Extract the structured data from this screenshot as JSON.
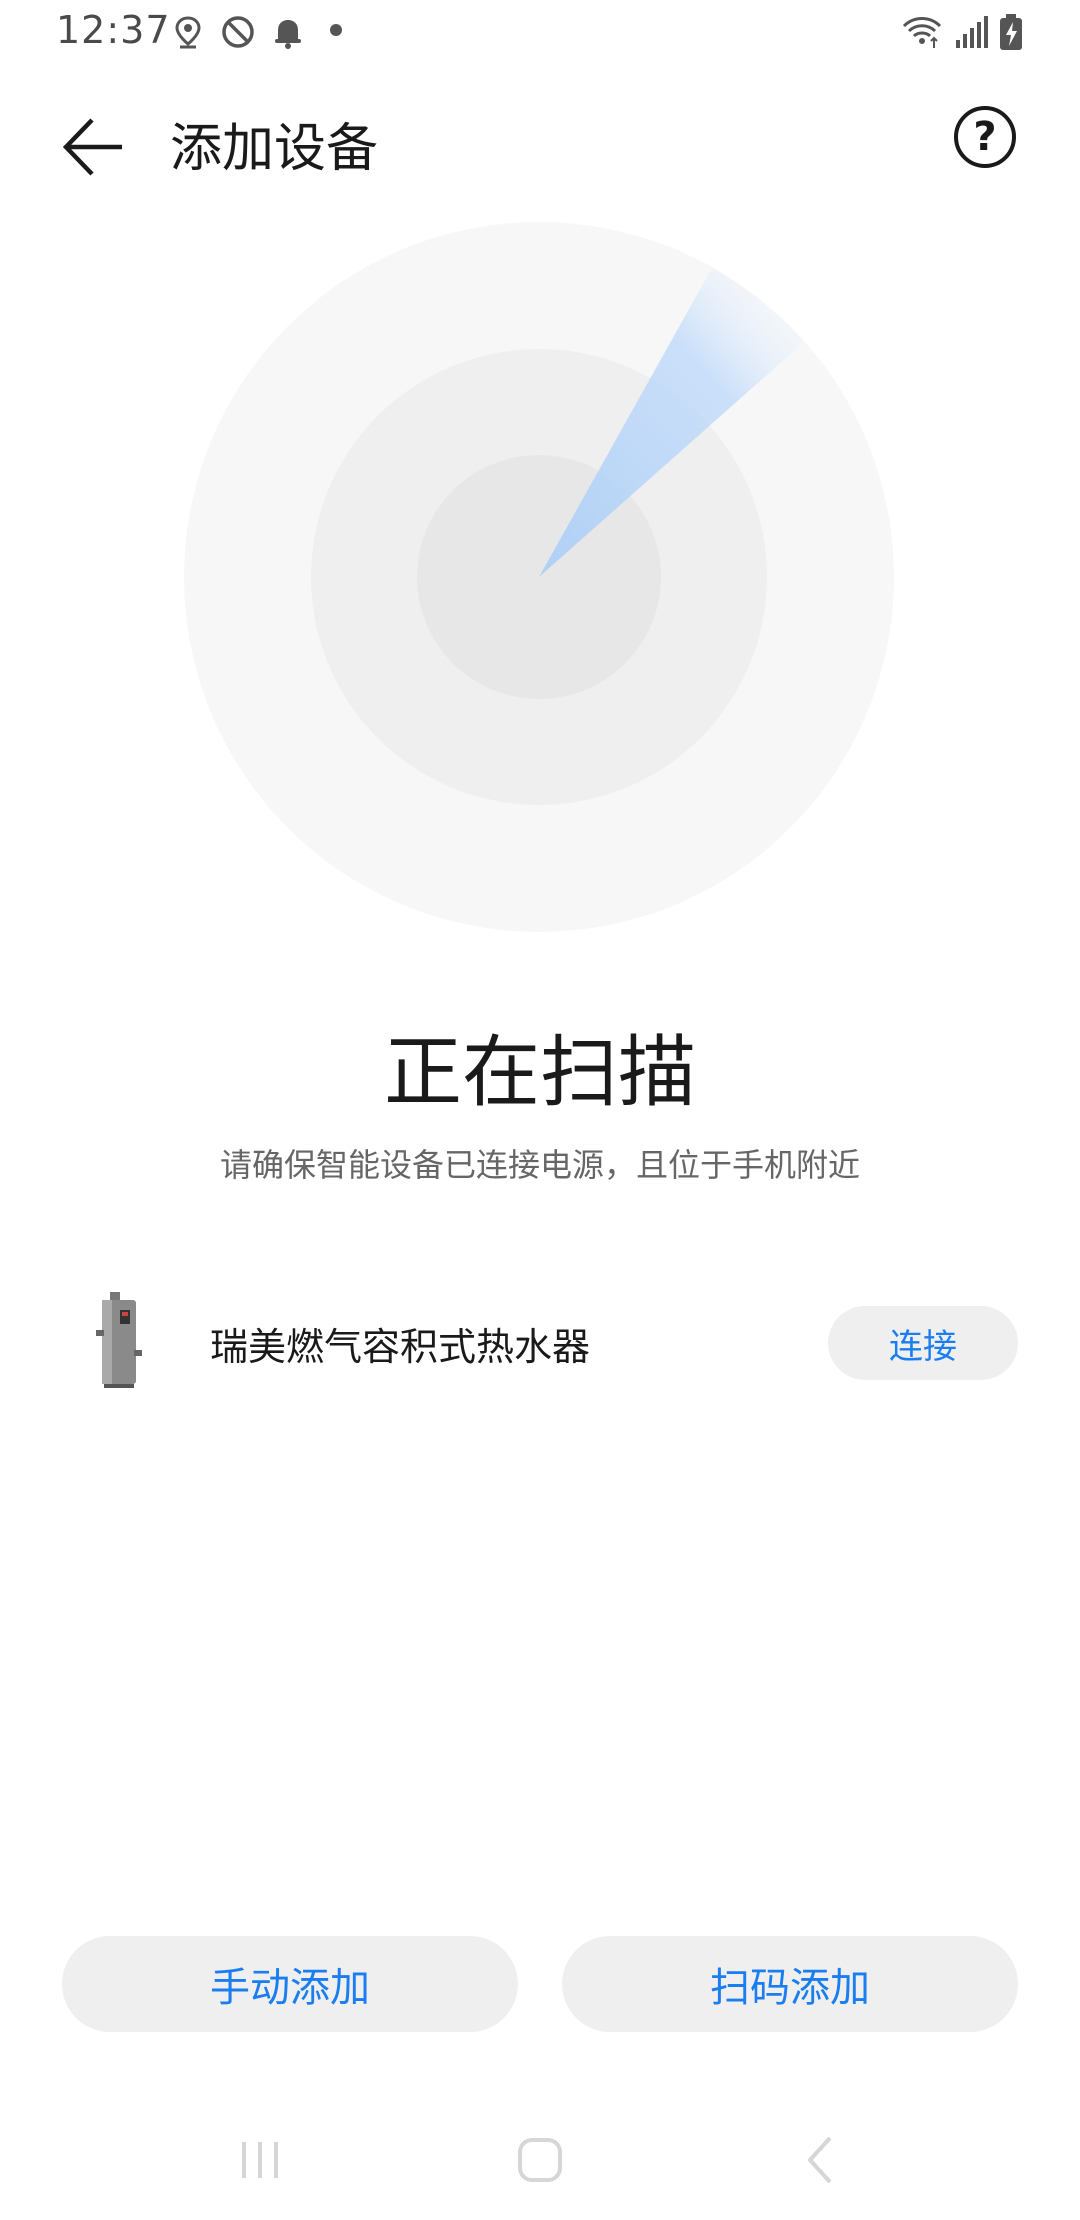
{
  "status_bar": {
    "time": "12:37",
    "icons": [
      "location-icon",
      "no-disturb-icon",
      "bell-icon",
      "wifi-icon",
      "signal-icon",
      "battery-charging-icon"
    ]
  },
  "app_bar": {
    "title": "添加设备",
    "help_label": "?"
  },
  "scan": {
    "title": "正在扫描",
    "subtitle": "请确保智能设备已连接电源，且位于手机附近"
  },
  "devices": [
    {
      "name": "瑞美燃气容积式热水器",
      "action_label": "连接"
    }
  ],
  "bottom_actions": {
    "manual_label": "手动添加",
    "scan_code_label": "扫码添加"
  },
  "colors": {
    "accent": "#1a7df0",
    "button_bg": "#efefef",
    "radar_outer": "#f7f7f7",
    "radar_middle": "#efefef",
    "radar_inner": "#e7e7e7",
    "sweep": "#a9cdf7"
  }
}
